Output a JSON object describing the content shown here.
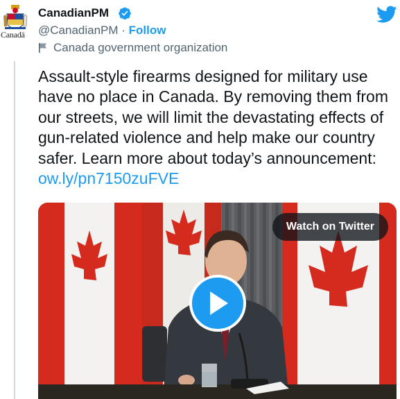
{
  "author": {
    "name": "CanadianPM",
    "handle": "@CanadianPM",
    "separator": " · ",
    "follow_label": "Follow",
    "organization_label": "Canada government organization",
    "logo_wordmark": "Canadä"
  },
  "tweet": {
    "text": "Assault-style firearms designed for military use have no place in Canada. By removing them from our streets, we will limit the devastating effects of gun-related violence and help make our country safer. Learn more about today’s announcement: ",
    "link": "ow.ly/pn7150zuFVE"
  },
  "media": {
    "watch_label": "Watch on Twitter"
  },
  "icons": {
    "verified": "verified-badge-icon",
    "organization": "flag-icon",
    "platform": "twitter-bird-icon",
    "play": "play-icon"
  },
  "colors": {
    "accent": "#1d9bf0",
    "text": "#0f1419",
    "secondary": "#536471",
    "flag_red": "#d52b1e"
  }
}
